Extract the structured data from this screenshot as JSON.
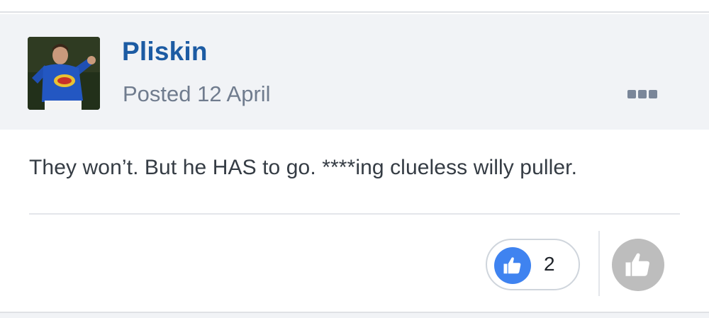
{
  "post": {
    "author": "Pliskin",
    "posted_label": "Posted",
    "posted_date": "12 April",
    "avatar_icon": "user-avatar-photo",
    "more_icon": "more-options-icon",
    "body_text": "They won’t. But he HAS to go. ****ing clueless willy puller."
  },
  "reactions": {
    "like_icon": "thumbs-up-icon",
    "like_count": "2",
    "react_icon": "thumbs-up-icon",
    "like_color": "#3f83f0",
    "react_color": "#bdbdbd"
  }
}
